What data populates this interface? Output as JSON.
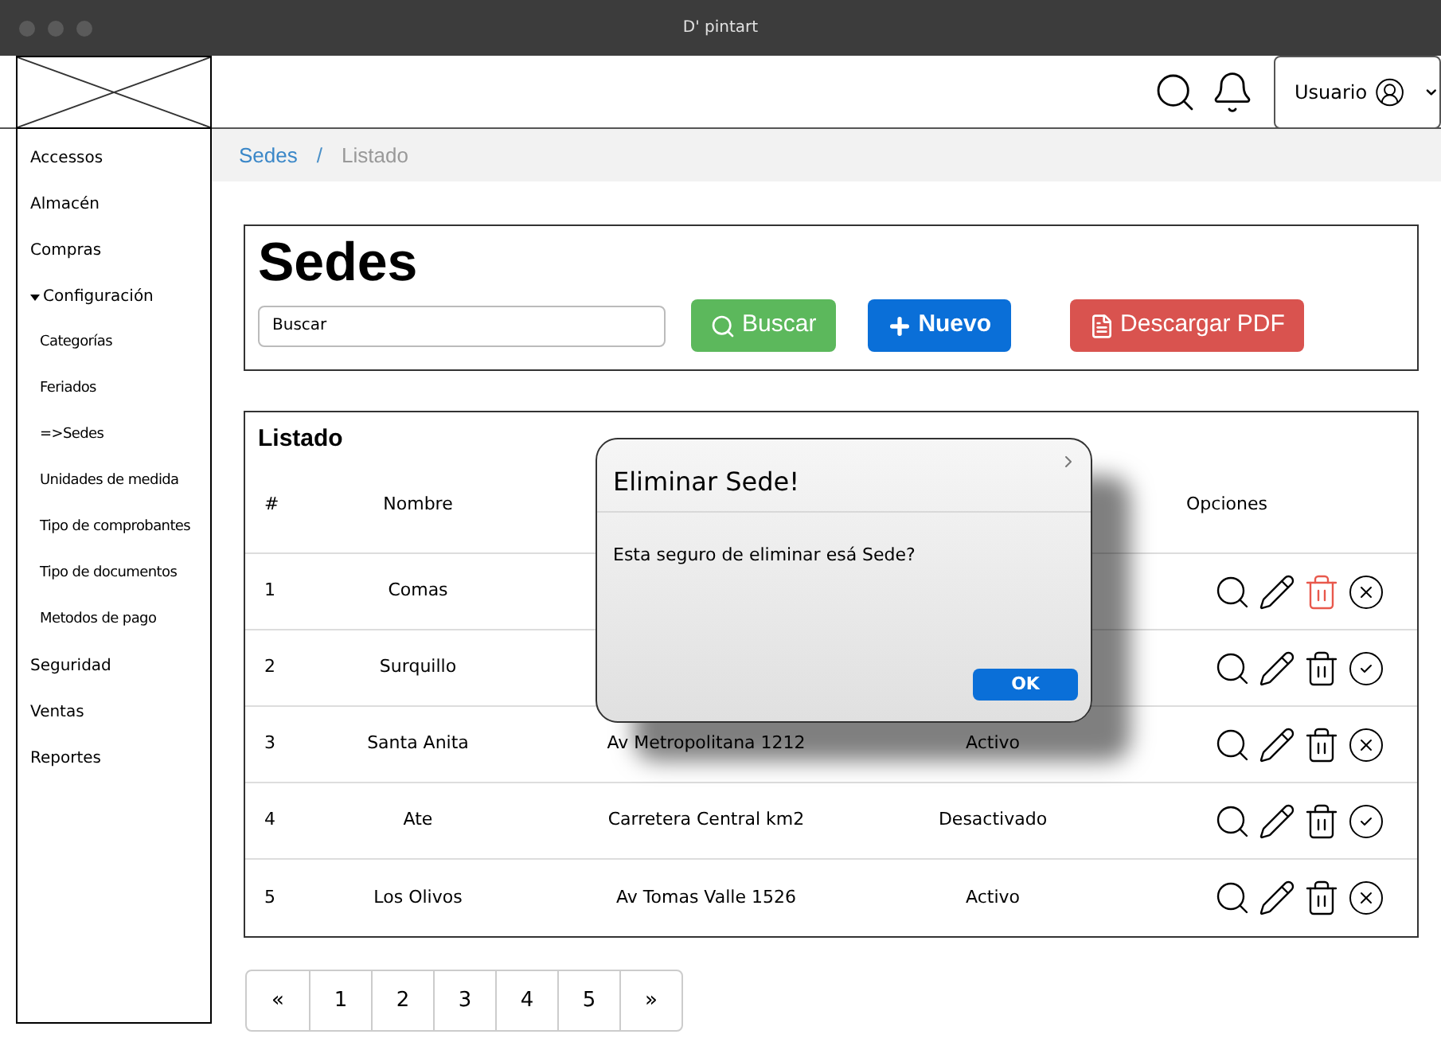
{
  "window": {
    "title": "D' pintart"
  },
  "header": {
    "user_label": "Usuario"
  },
  "sidebar": {
    "items": [
      {
        "label": "Accessos",
        "expanded": false
      },
      {
        "label": "Almacén",
        "expanded": false
      },
      {
        "label": "Compras",
        "expanded": false
      },
      {
        "label": "Configuración",
        "expanded": true,
        "children": [
          {
            "label": "Categorías"
          },
          {
            "label": "Feriados"
          },
          {
            "label": "=>Sedes"
          },
          {
            "label": "Unidades de medida"
          },
          {
            "label": "Tipo de comprobantes"
          },
          {
            "label": "Tipo de documentos"
          },
          {
            "label": "Metodos de pago"
          }
        ]
      },
      {
        "label": "Seguridad",
        "expanded": false
      },
      {
        "label": "Ventas",
        "expanded": false
      },
      {
        "label": "Reportes",
        "expanded": false
      }
    ]
  },
  "breadcrumb_separator": "/",
  "breadcrumb": [
    {
      "label": "Sedes",
      "link": true
    },
    {
      "label": "Listado",
      "link": false
    }
  ],
  "page_title": "Sedes",
  "search": {
    "value": "Buscar"
  },
  "buttons": [
    {
      "kind": "search",
      "label": "Buscar"
    },
    {
      "kind": "new",
      "label": "Nuevo"
    },
    {
      "kind": "pdf",
      "label": "Descargar PDF"
    }
  ],
  "table": {
    "title": "Listado",
    "columns": [
      "#",
      "Nombre",
      "Opciones"
    ],
    "rows": [
      {
        "number": "1",
        "name": "Comas",
        "active": true,
        "delete_highlighted": true
      },
      {
        "number": "2",
        "name": "Surquillo",
        "active": false,
        "delete_highlighted": false
      },
      {
        "number": "3",
        "name": "Santa Anita",
        "address": "Av Metropolitana 1212",
        "status": "Activo",
        "active": true,
        "delete_highlighted": false
      },
      {
        "number": "4",
        "name": "Ate",
        "address": "Carretera Central km2",
        "status": "Desactivado",
        "active": false,
        "delete_highlighted": false
      },
      {
        "number": "5",
        "name": "Los Olivos",
        "address": "Av Tomas Valle 1526",
        "status": "Activo",
        "active": true,
        "delete_highlighted": false
      }
    ]
  },
  "pagination": [
    "«",
    "1",
    "2",
    "3",
    "4",
    "5",
    "»"
  ],
  "dialog": {
    "title": "Eliminar Sede!",
    "message": "Esta seguro de eliminar esá Sede?",
    "button": "OK"
  }
}
